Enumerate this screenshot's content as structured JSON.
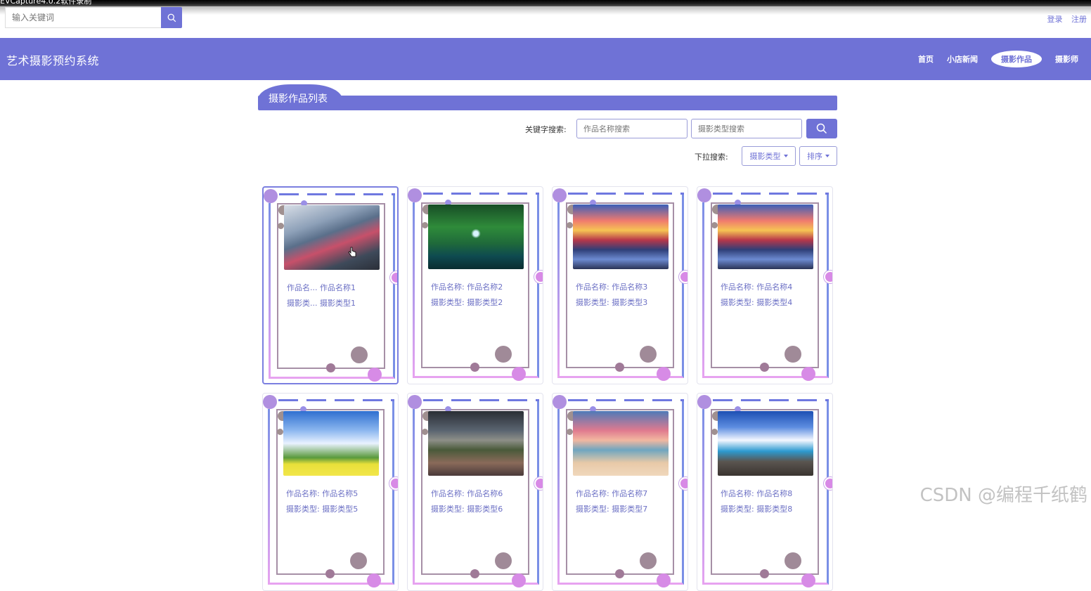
{
  "capture_title": "EVCapture4.0.2软件录制",
  "top_search": {
    "placeholder": "输入关键词"
  },
  "auth": {
    "login": "登录",
    "register": "注册"
  },
  "header": {
    "brand": "艺术摄影预约系统",
    "nav": [
      "首页",
      "小店新闻",
      "摄影作品",
      "摄影师"
    ],
    "active_nav": "摄影作品"
  },
  "section": {
    "title": "摄影作品列表"
  },
  "search": {
    "label": "关键字搜索:",
    "name_placeholder": "作品名称搜索",
    "type_placeholder": "摄影类型搜索"
  },
  "dropdown": {
    "label": "下拉搜索:",
    "type_button": "摄影类型",
    "sort_button": "排序"
  },
  "cards": [
    {
      "name_label": "作品名...",
      "name": "作品名称1",
      "type_label": "摄影类...",
      "type": "摄影类型1"
    },
    {
      "name_label": "作品名称:",
      "name": "作品名称2",
      "type_label": "摄影类型:",
      "type": "摄影类型2"
    },
    {
      "name_label": "作品名称:",
      "name": "作品名称3",
      "type_label": "摄影类型:",
      "type": "摄影类型3"
    },
    {
      "name_label": "作品名称:",
      "name": "作品名称4",
      "type_label": "摄影类型:",
      "type": "摄影类型4"
    },
    {
      "name_label": "作品名称:",
      "name": "作品名称5",
      "type_label": "摄影类型:",
      "type": "摄影类型5"
    },
    {
      "name_label": "作品名称:",
      "name": "作品名称6",
      "type_label": "摄影类型:",
      "type": "摄影类型6"
    },
    {
      "name_label": "作品名称:",
      "name": "作品名称7",
      "type_label": "摄影类型:",
      "type": "摄影类型7"
    },
    {
      "name_label": "作品名称:",
      "name": "作品名称8",
      "type_label": "摄影类型:",
      "type": "摄影类型8"
    }
  ],
  "watermark": "CSDN @编程千纸鹤",
  "colors": {
    "primary": "#6f72d6",
    "accent_pink": "#e7a3f0",
    "frame_mauve": "#a68fa6"
  }
}
